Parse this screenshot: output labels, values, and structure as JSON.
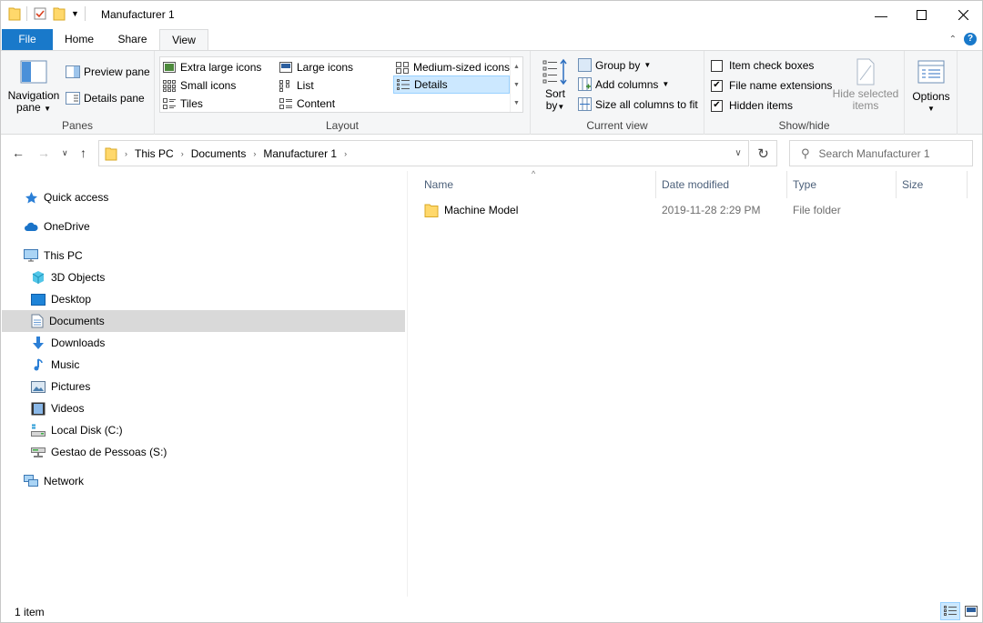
{
  "window": {
    "title": "Manufacturer 1"
  },
  "tabs": {
    "file": "File",
    "home": "Home",
    "share": "Share",
    "view": "View"
  },
  "ribbon": {
    "panes": {
      "label": "Panes",
      "navigation_pane": [
        "Navigation",
        "pane"
      ],
      "preview_pane": "Preview pane",
      "details_pane": "Details pane"
    },
    "layout": {
      "label": "Layout",
      "items": [
        "Extra large icons",
        "Large icons",
        "Medium-sized icons",
        "Small icons",
        "List",
        "Details",
        "Tiles",
        "Content"
      ],
      "selected": "Details"
    },
    "current_view": {
      "label": "Current view",
      "sort_by": [
        "Sort",
        "by"
      ],
      "group_by": "Group by",
      "add_columns": "Add columns",
      "size_all_columns": "Size all columns to fit"
    },
    "show_hide": {
      "label": "Show/hide",
      "item_check_boxes": "Item check boxes",
      "file_name_extensions": "File name extensions",
      "hidden_items": "Hidden items",
      "checked": {
        "item_check_boxes": false,
        "file_name_extensions": true,
        "hidden_items": true
      },
      "hide_selected_items": [
        "Hide selected",
        "items"
      ]
    },
    "options": {
      "label": "Options"
    }
  },
  "address": {
    "breadcrumb": [
      "This PC",
      "Documents",
      "Manufacturer 1"
    ],
    "search_placeholder": "Search Manufacturer 1"
  },
  "nav_pane": {
    "items": [
      {
        "label": "Quick access",
        "icon": "star-icon"
      },
      {
        "label": "OneDrive",
        "icon": "cloud-icon"
      },
      {
        "label": "This PC",
        "icon": "computer-icon"
      },
      {
        "label": "3D Objects",
        "icon": "cube-icon"
      },
      {
        "label": "Desktop",
        "icon": "desktop-icon"
      },
      {
        "label": "Documents",
        "icon": "document-icon"
      },
      {
        "label": "Downloads",
        "icon": "download-arrow-icon"
      },
      {
        "label": "Music",
        "icon": "music-note-icon"
      },
      {
        "label": "Pictures",
        "icon": "picture-icon"
      },
      {
        "label": "Videos",
        "icon": "film-icon"
      },
      {
        "label": "Local Disk (C:)",
        "icon": "drive-icon"
      },
      {
        "label": "Gestao de Pessoas (S:)",
        "icon": "network-drive-icon"
      },
      {
        "label": "Network",
        "icon": "network-icon"
      }
    ],
    "selected": "Documents"
  },
  "file_list": {
    "columns": [
      "Name",
      "Date modified",
      "Type",
      "Size"
    ],
    "rows": [
      {
        "name": "Machine Model",
        "date_modified": "2019-11-28 2:29 PM",
        "type": "File folder",
        "size": ""
      }
    ]
  },
  "status_bar": {
    "item_count": "1 item"
  },
  "colors": {
    "accent": "#1979ca",
    "selection": "#cce8ff",
    "folder": "#ffd86b"
  }
}
